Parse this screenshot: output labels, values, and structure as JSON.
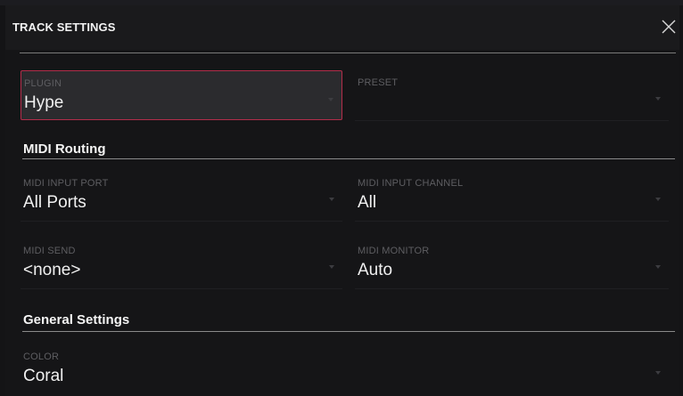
{
  "dialog": {
    "title": "TRACK SETTINGS",
    "close_icon": "close-icon"
  },
  "plugin": {
    "label": "PLUGIN",
    "value": "Hype"
  },
  "preset": {
    "label": "PRESET",
    "value": ""
  },
  "midi_routing": {
    "title": "MIDI Routing",
    "input_port": {
      "label": "MIDI INPUT PORT",
      "value": "All Ports"
    },
    "input_channel": {
      "label": "MIDI INPUT CHANNEL",
      "value": "All"
    },
    "send": {
      "label": "MIDI SEND",
      "value": "<none>"
    },
    "monitor": {
      "label": "MIDI MONITOR",
      "value": "Auto"
    }
  },
  "general_settings": {
    "title": "General Settings",
    "color": {
      "label": "COLOR",
      "value": "Coral"
    }
  },
  "colors": {
    "accent_border": "#b32d4a",
    "background": "#151517"
  }
}
